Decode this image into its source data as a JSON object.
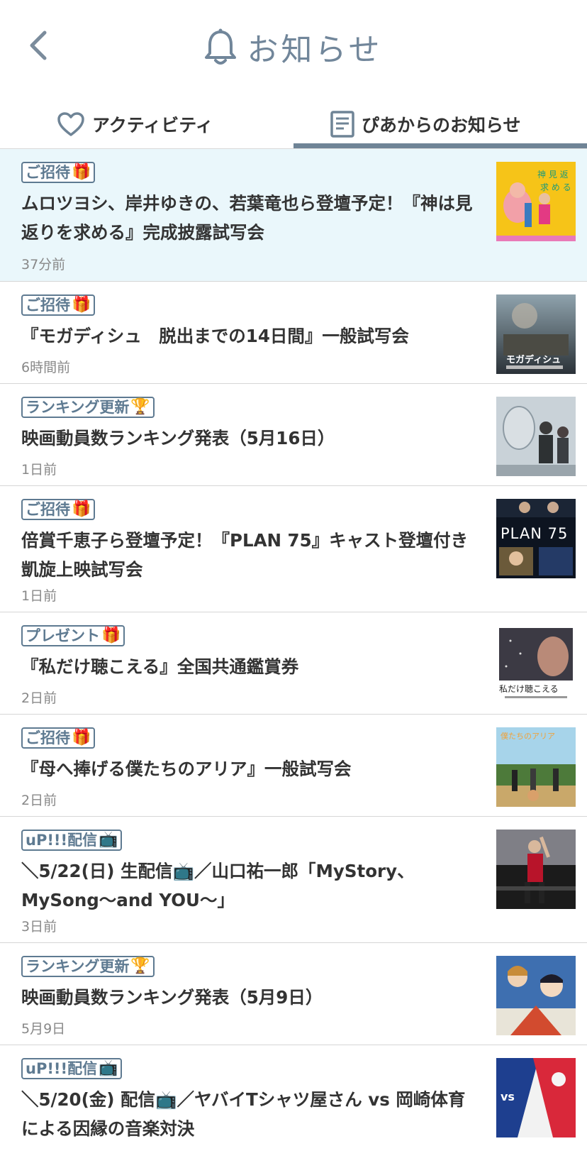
{
  "header": {
    "title": "お知らせ"
  },
  "tabs": [
    {
      "label": "アクティビティ"
    },
    {
      "label": "ぴあからのお知らせ"
    }
  ],
  "colors": {
    "accent": "#6f8496",
    "highlight_bg": "#eaf7fb",
    "tag": "#5e7a91"
  },
  "notifications": [
    {
      "tag": "ご招待",
      "tag_emoji": "🎁",
      "title": "ムロツヨシ、岸井ゆきの、若葉竜也ら登壇予定！『神は見返りを求める』完成披露試写会",
      "time": "37分前"
    },
    {
      "tag": "ご招待",
      "tag_emoji": "🎁",
      "title": "『モガディシュ　脱出までの14日間』一般試写会",
      "time": "6時間前"
    },
    {
      "tag": "ランキング更新",
      "tag_emoji": "🏆",
      "title": "映画動員数ランキング発表（5月16日）",
      "time": "1日前"
    },
    {
      "tag": "ご招待",
      "tag_emoji": "🎁",
      "title": "倍賞千恵子ら登壇予定！『PLAN 75』キャスト登壇付き凱旋上映試写会",
      "time": "1日前"
    },
    {
      "tag": "プレゼント",
      "tag_emoji": "🎁",
      "title": "『私だけ聴こえる』全国共通鑑賞券",
      "time": "2日前"
    },
    {
      "tag": "ご招待",
      "tag_emoji": "🎁",
      "title": "『母へ捧げる僕たちのアリア』一般試写会",
      "time": "2日前"
    },
    {
      "tag": "uP!!!配信",
      "tag_emoji": "📺",
      "title": "＼5/22(日) 生配信📺／山口祐一郎「MyStory、MySong〜and YOU〜」",
      "time": "3日前"
    },
    {
      "tag": "ランキング更新",
      "tag_emoji": "🏆",
      "title": "映画動員数ランキング発表（5月9日）",
      "time": "5月9日"
    },
    {
      "tag": "uP!!!配信",
      "tag_emoji": "📺",
      "title": "＼5/20(金) 配信📺／ヤバイTシャツ屋さん vs 岡崎体育による因縁の音楽対決",
      "time": ""
    }
  ],
  "thumb_text": {
    "mogadishu": "モガディシュ",
    "plan75": "PLAN 75",
    "watashi": "私だけ聴こえる",
    "aria": "僕たちのアリア"
  }
}
